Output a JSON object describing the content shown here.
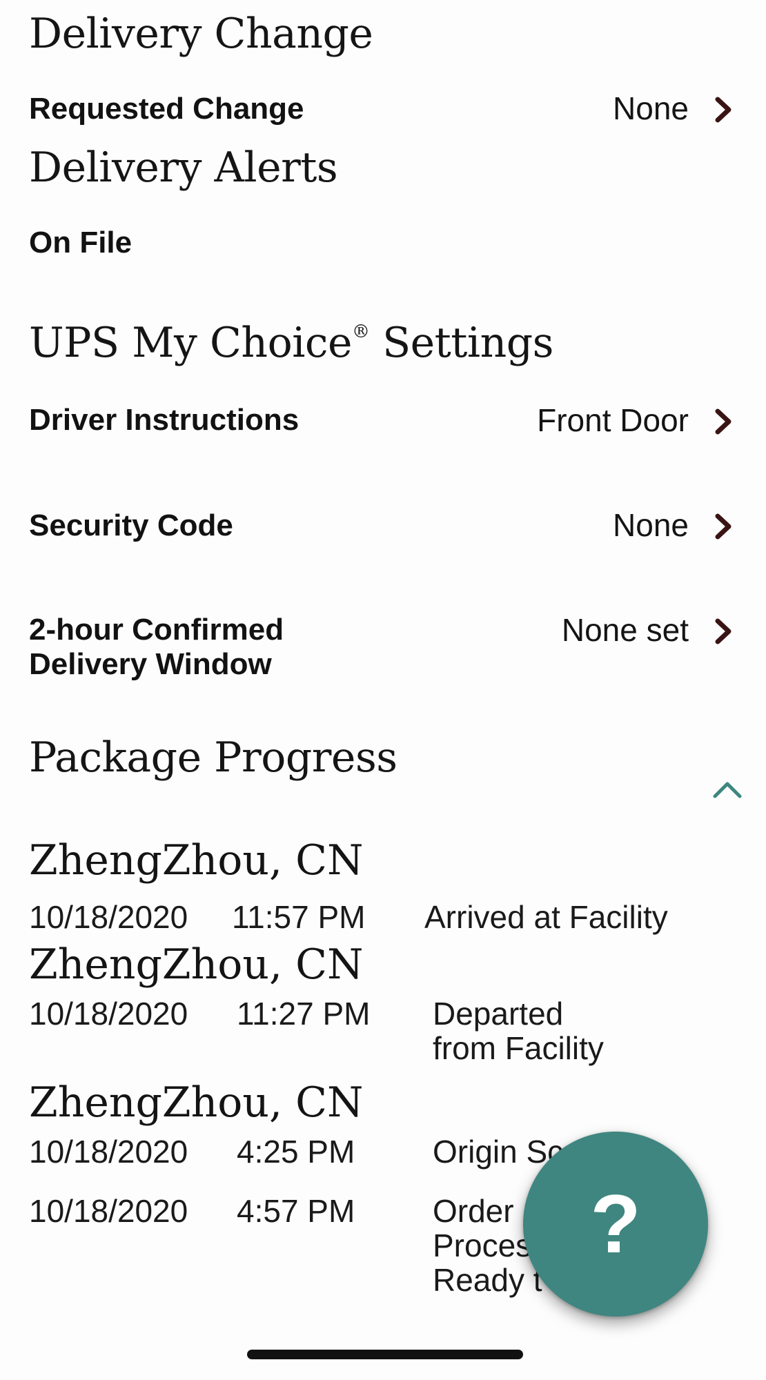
{
  "delivery_change": {
    "title": "Delivery Change",
    "requested_change": {
      "label": "Requested Change",
      "value": "None"
    }
  },
  "delivery_alerts": {
    "title": "Delivery Alerts",
    "on_file_label": "On File"
  },
  "my_choice": {
    "title_prefix": "UPS My Choice",
    "title_reg": "®",
    "title_suffix": " Settings",
    "driver_instructions": {
      "label": "Driver Instructions",
      "value": "Front Door"
    },
    "security_code": {
      "label": "Security Code",
      "value": "None"
    },
    "delivery_window": {
      "label_line1": "2-hour Confirmed",
      "label_line2": "Delivery Window",
      "value": "None set"
    }
  },
  "package_progress": {
    "title": "Package Progress",
    "collapse_icon": "chevron-up-icon",
    "events": [
      {
        "location": "ZhengZhou, CN",
        "date": "10/18/2020",
        "time": "11:57 PM",
        "status_lines": [
          "Arrived at Facility"
        ]
      },
      {
        "location": "ZhengZhou, CN",
        "date": "10/18/2020",
        "time": "11:27 PM",
        "status_lines": [
          "Departed",
          "from Facility"
        ]
      },
      {
        "location": "ZhengZhou, CN",
        "date": "10/18/2020",
        "time": "4:25 PM",
        "status_lines": [
          "Origin Sc"
        ]
      },
      {
        "location": "",
        "date": "10/18/2020",
        "time": "4:57 PM",
        "status_lines": [
          "Order",
          "Proces",
          "Ready t"
        ]
      }
    ]
  },
  "help_button": {
    "label": "?"
  },
  "colors": {
    "accent": "#3f8680",
    "chevron": "#3a1414",
    "text": "#141414"
  }
}
